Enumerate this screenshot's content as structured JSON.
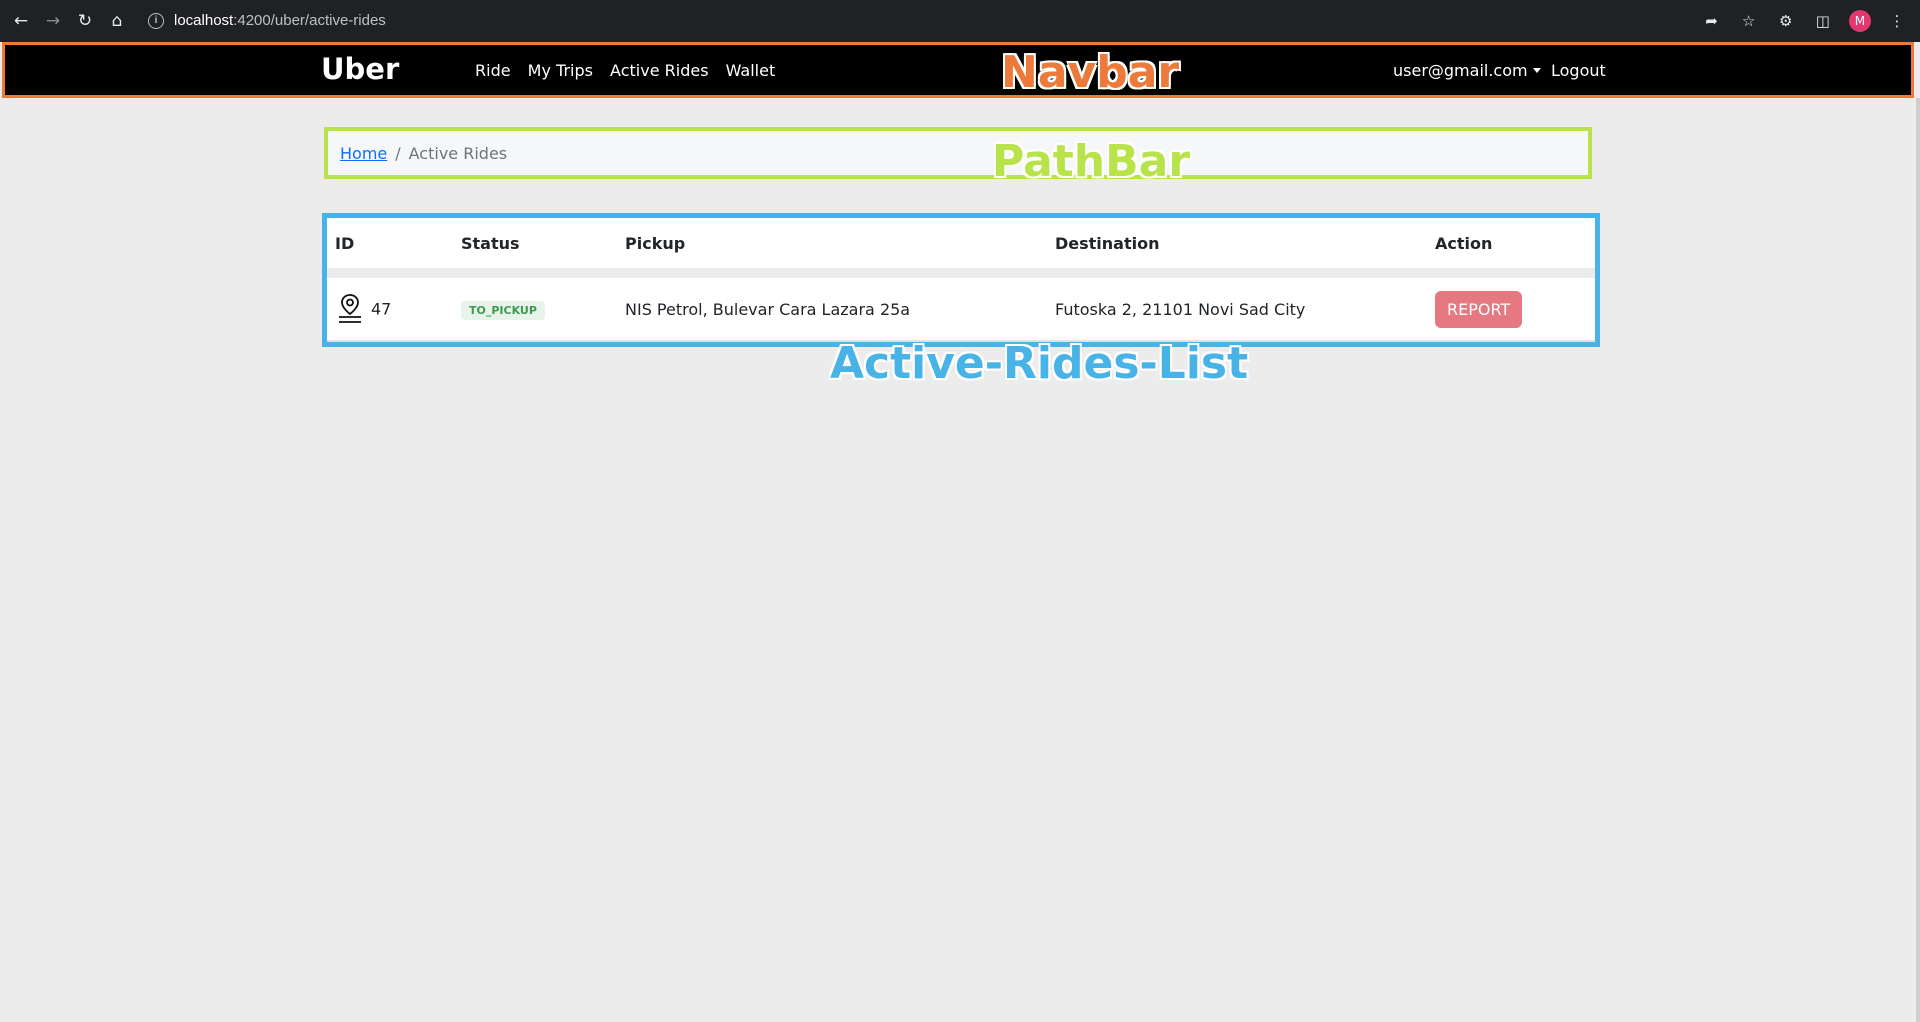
{
  "browser": {
    "url_host": "localhost",
    "url_path": ":4200/uber/active-rides",
    "profile_initial": "M"
  },
  "navbar": {
    "brand": "Uber",
    "links": [
      "Ride",
      "My Trips",
      "Active Rides",
      "Wallet"
    ],
    "user_email": "user@gmail.com",
    "logout_label": "Logout",
    "annotation": "Navbar"
  },
  "pathbar": {
    "home_label": "Home",
    "separator": "/",
    "current": "Active Rides",
    "annotation": "PathBar"
  },
  "rides": {
    "headers": [
      "ID",
      "Status",
      "Pickup",
      "Destination",
      "Action"
    ],
    "rows": [
      {
        "id": "47",
        "status": "TO_PICKUP",
        "pickup": "NIS Petrol, Bulevar Cara Lazara 25a",
        "destination": "Futoska 2, 21101 Novi Sad City",
        "action": "REPORT"
      }
    ],
    "annotation": "Active-Rides-List"
  },
  "colors": {
    "navbar_annotation": "#ec7a3a",
    "pathbar_annotation": "#b9e34a",
    "rides_annotation": "#48b3e6",
    "report_button": "#e57880"
  }
}
